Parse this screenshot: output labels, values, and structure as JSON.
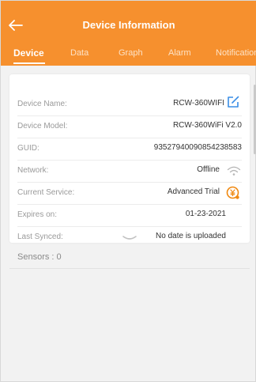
{
  "header": {
    "title": "Device Information",
    "tabs": [
      {
        "label": "Device",
        "active": true
      },
      {
        "label": "Data",
        "active": false
      },
      {
        "label": "Graph",
        "active": false
      },
      {
        "label": "Alarm",
        "active": false
      },
      {
        "label": "Notification",
        "active": false
      }
    ]
  },
  "device": {
    "rows": [
      {
        "label": "Device Name:",
        "value": "RCW-360WIFI",
        "icon": "edit-icon"
      },
      {
        "label": "Device Model:",
        "value": "RCW-360WiFi V2.0"
      },
      {
        "label": "GUID:",
        "value": "93527940090854238583"
      },
      {
        "label": "Network:",
        "value": "Offline",
        "icon": "wifi-icon"
      },
      {
        "label": "Current Service:",
        "value": "Advanced Trial",
        "icon": "service-coin-icon"
      },
      {
        "label": "Expires on:",
        "value": "01-23-2021"
      },
      {
        "label": "Last Synced:",
        "value": "No date is uploaded"
      }
    ]
  },
  "sensors": {
    "label": "Sensors : 0"
  },
  "colors": {
    "accent": "#f6902e",
    "icon_blue": "#3a8ee6",
    "icon_orange": "#f0880f",
    "muted": "#9a9a9a"
  }
}
